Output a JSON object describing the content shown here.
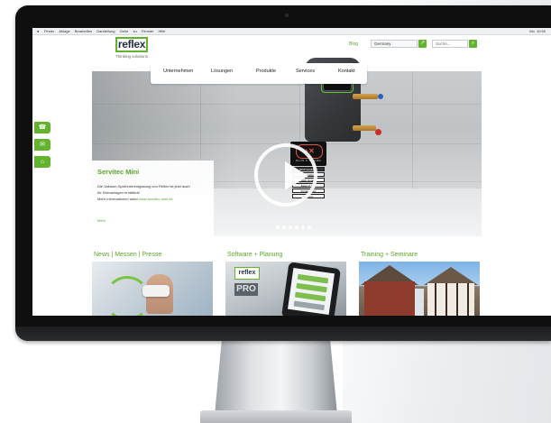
{
  "menubar": {
    "apple": "",
    "menus": "Finder Ablage Bearbeiten Darstellung Gehe zu Fenster Hilfe",
    "status": "Mo. 10:55"
  },
  "header": {
    "logo_text": "reflex",
    "tagline": "Thinking solutions.",
    "blog_label": "Blog",
    "language_value": "Germany",
    "search_placeholder": "Suche..."
  },
  "nav": {
    "items": [
      "Unternehmen",
      "Lösungen",
      "Produkte",
      "Services",
      "Kontakt"
    ]
  },
  "hero": {
    "title": "Servitec Mini",
    "text_line1": "Die Vakuum-Sprührohrentgasung von Reflex ist jetzt auch",
    "text_line2": "für Kleinanlagen erhältlich!",
    "text_line3_prefix": "Mehr Informationen unter ",
    "text_link": "www.servitec-mini.de",
    "more_label": "Mehr",
    "award": {
      "name": "PLUS X AWARD",
      "rows": [
        "2016 Gewinner",
        "Innovation",
        "High Quality",
        "Ease of Use",
        "Funktionality",
        "Ecology"
      ]
    },
    "slide_count": 6,
    "active_slide": 1
  },
  "sideicons": [
    "chat-icon",
    "mail-icon",
    "tag-icon"
  ],
  "tiles": [
    {
      "title": "News | Messen | Presse"
    },
    {
      "title": "Software + Planung",
      "badge_logo": "reflex",
      "badge_text": "PRO"
    },
    {
      "title": "Training + Seminare"
    }
  ],
  "colors": {
    "brand_green": "#63b32e",
    "text_green": "#5aa62a",
    "bezel": "#0f0f10"
  }
}
